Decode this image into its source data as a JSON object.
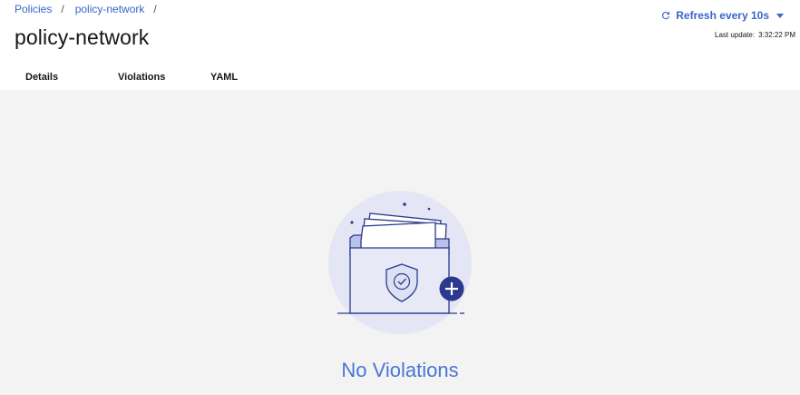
{
  "breadcrumb": {
    "items": [
      "Policies",
      "policy-network"
    ],
    "separator": "/"
  },
  "page_title": "policy-network",
  "refresh": {
    "label": "Refresh every 10s",
    "icon": "refresh-icon",
    "dropdown_icon": "caret-down-icon"
  },
  "last_update": {
    "label": "Last update:",
    "time": "3:32:22 PM"
  },
  "tabs": [
    {
      "label": "Details",
      "active": false
    },
    {
      "label": "Violations",
      "active": true
    },
    {
      "label": "YAML",
      "active": false
    }
  ],
  "empty_state": {
    "title": "No Violations",
    "illustration": "folder-shield-illustration"
  },
  "colors": {
    "accent": "#3a66c8",
    "empty_title": "#4a76d2",
    "content_bg": "#f3f3f3",
    "illustration_navy": "#2b3a8c"
  }
}
